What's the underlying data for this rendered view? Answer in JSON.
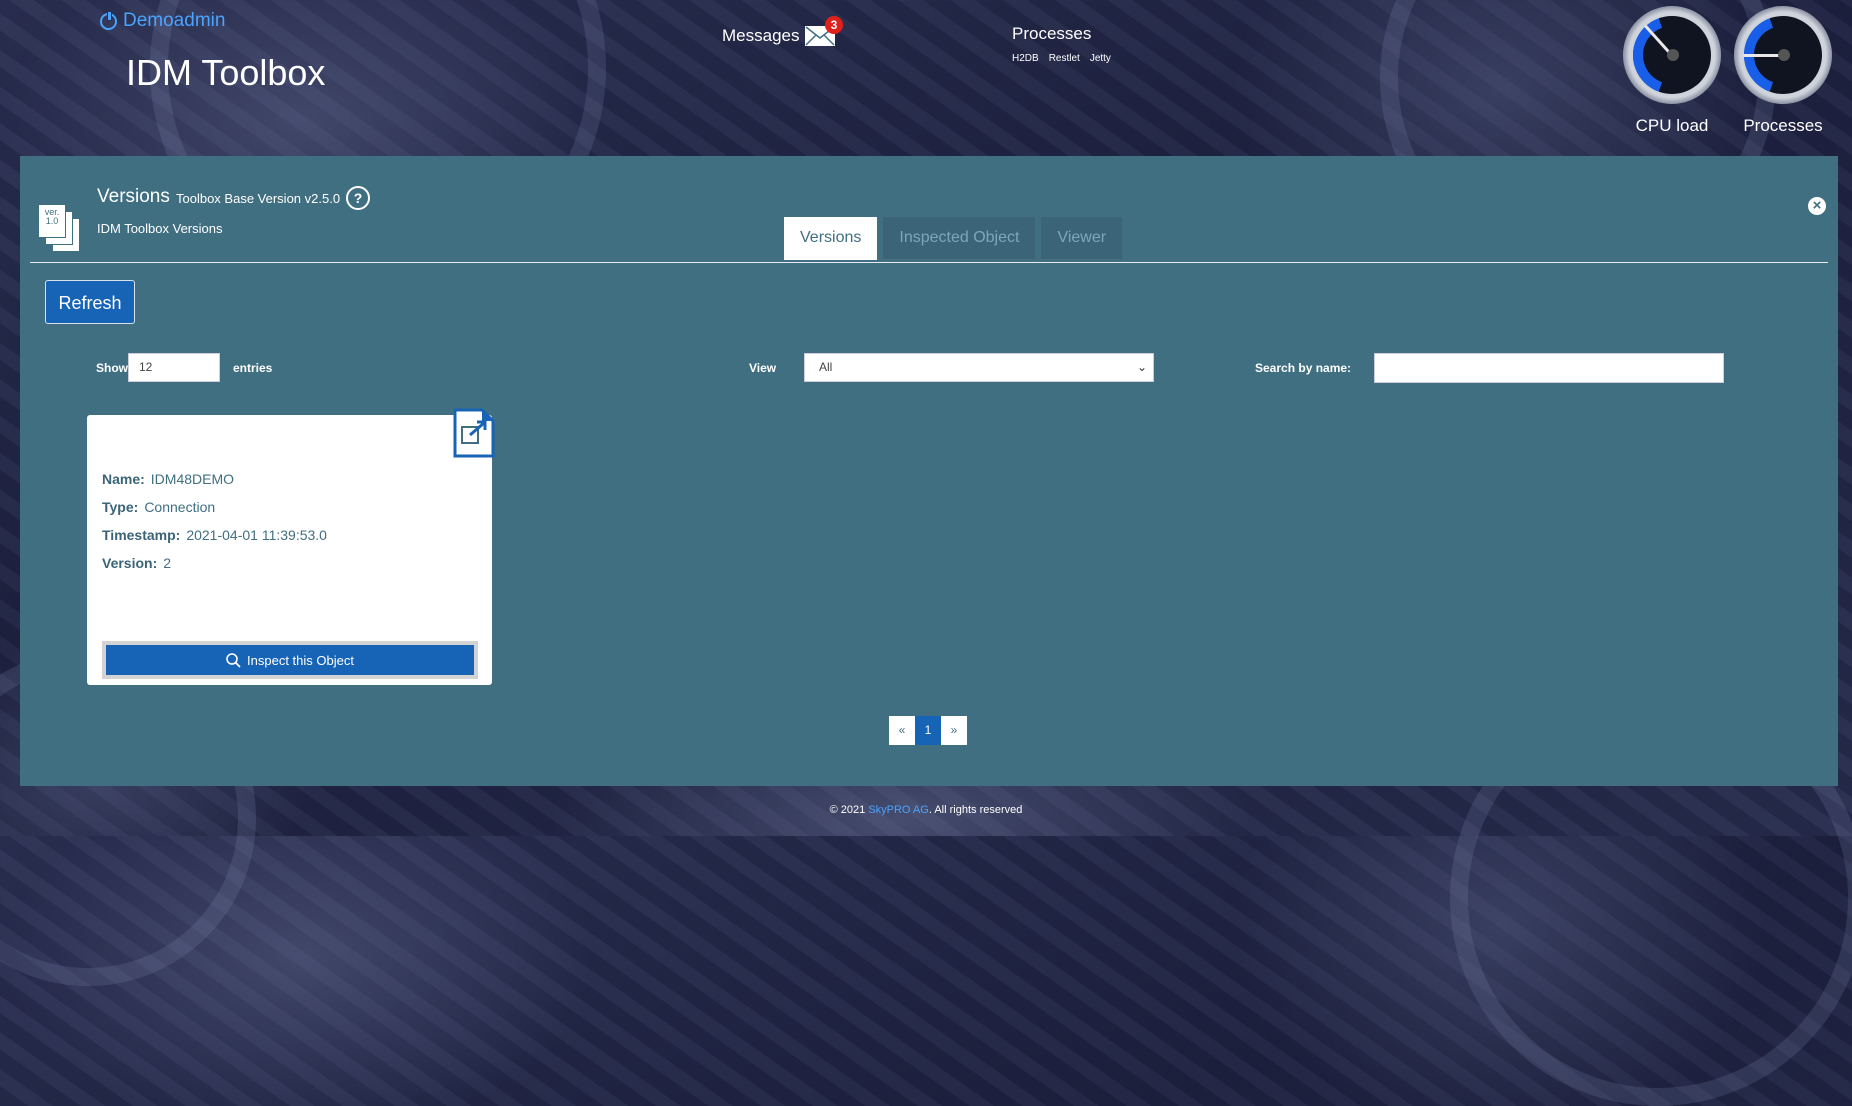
{
  "header": {
    "user": "Demoadmin",
    "app_title": "IDM Toolbox",
    "messages_label": "Messages",
    "messages_count": "3",
    "processes_title": "Processes",
    "process_links": [
      "H2DB",
      "Restlet",
      "Jetty"
    ],
    "gauges": [
      {
        "label": "CPU load"
      },
      {
        "label": "Processes"
      }
    ]
  },
  "panel": {
    "icon_text": [
      "ver.",
      "1.0"
    ],
    "title": "Versions",
    "base_version": "Toolbox Base Version v2.5.0",
    "subtitle": "IDM Toolbox Versions",
    "help_icon": "?",
    "tabs": [
      {
        "label": "Versions",
        "active": true
      },
      {
        "label": "Inspected Object",
        "active": false
      },
      {
        "label": "Viewer",
        "active": false
      }
    ],
    "refresh_label": "Refresh",
    "show_label": "Show",
    "show_value": "12",
    "entries_label": "entries",
    "view_label": "View",
    "view_value": "All",
    "search_label": "Search by name:",
    "search_value": ""
  },
  "card": {
    "fields": [
      {
        "key": "Name:",
        "value": "IDM48DEMO"
      },
      {
        "key": "Type:",
        "value": "Connection"
      },
      {
        "key": "Timestamp:",
        "value": "2021-04-01 11:39:53.0"
      },
      {
        "key": "Version:",
        "value": "2"
      }
    ],
    "inspect_label": "Inspect this Object"
  },
  "pagination": {
    "prev": "«",
    "page": "1",
    "next": "»"
  },
  "footer": {
    "prefix": "© 2021",
    "company": "SkyPRO AG",
    "suffix": ". All rights reserved"
  },
  "colors": {
    "panel": "#406f82",
    "accent": "#1764b7",
    "link": "#4aa3ff",
    "badge": "#e0201b"
  }
}
